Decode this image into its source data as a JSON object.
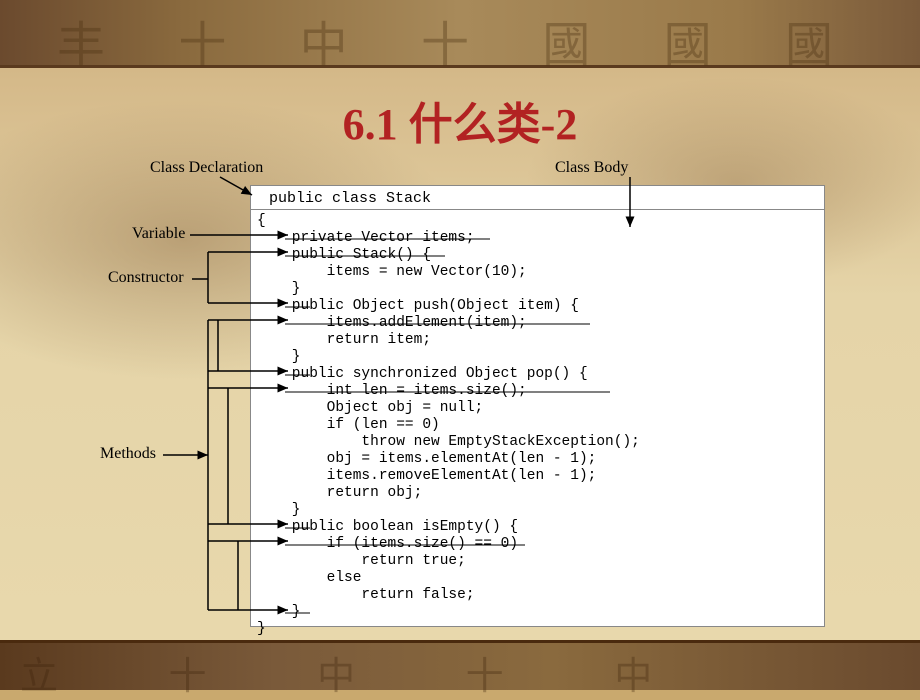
{
  "title": "6.1  什么类-2",
  "labels": {
    "classDeclaration": "Class Declaration",
    "classBody": "Class Body",
    "variable": "Variable",
    "constructor": "Constructor",
    "methods": "Methods"
  },
  "code": {
    "declaration": "public class Stack",
    "body": "{\n    private Vector items;\n    public Stack() {\n        items = new Vector(10);\n    }\n    public Object push(Object item) {\n        items.addElement(item);\n        return item;\n    }\n    public synchronized Object pop() {\n        int len = items.size();\n        Object obj = null;\n        if (len == 0)\n            throw new EmptyStackException();\n        obj = items.elementAt(len - 1);\n        items.removeElementAt(len - 1);\n        return obj;\n    }\n    public boolean isEmpty() {\n        if (items.size() == 0)\n            return true;\n        else\n            return false;\n    }\n}"
  }
}
